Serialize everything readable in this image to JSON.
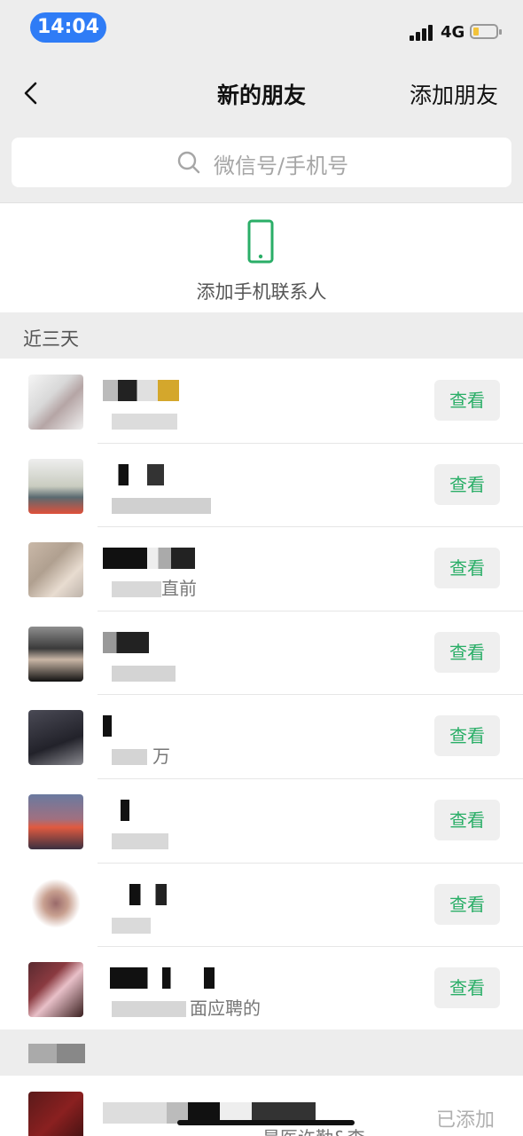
{
  "status_bar": {
    "time": "14:04",
    "network": "4G"
  },
  "nav": {
    "title": "新的朋友",
    "action_label": "添加朋友",
    "back_icon": "chevron-left-icon"
  },
  "search": {
    "placeholder": "微信号/手机号",
    "icon": "search-icon"
  },
  "add_phone_contacts": {
    "label": "添加手机联系人",
    "icon": "phone-icon",
    "color": "#2aae67"
  },
  "section": {
    "header": "近三天"
  },
  "friend_requests": [
    {
      "message_visible": "",
      "button": "查看"
    },
    {
      "message_visible": "",
      "button": "查看"
    },
    {
      "message_visible": "直前",
      "button": "查看"
    },
    {
      "message_visible": "",
      "button": "查看"
    },
    {
      "message_visible": "万",
      "button": "查看"
    },
    {
      "message_visible": "",
      "button": "查看"
    },
    {
      "message_visible": "",
      "button": "查看"
    },
    {
      "message_visible": "面应聘的",
      "button": "查看"
    }
  ],
  "older": {
    "status_label": "已添加",
    "message_visible": "是医许勤&李"
  },
  "colors": {
    "accent_green": "#2aae67",
    "time_pill": "#2f7cf6",
    "background": "#ededed"
  }
}
